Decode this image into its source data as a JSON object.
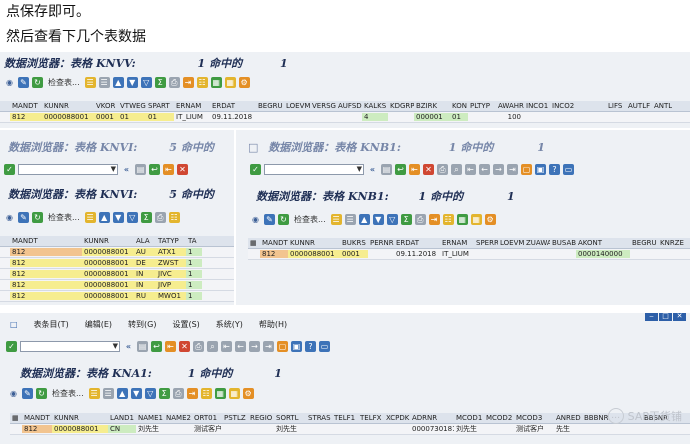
{
  "article": {
    "line1": "点保存即可。",
    "line2": "然后查看下几个表数据"
  },
  "knvv": {
    "title_prefix": "数据浏览器：表格",
    "table": "KNVV:",
    "count": "1",
    "count_label": "命中的",
    "count_total": "1",
    "toolbar_check": "检查表...",
    "columns": [
      "MANDT",
      "KUNNR",
      "VKOR",
      "VTWEG",
      "SPART",
      "ERNAM",
      "ERDAT",
      "BEGRU",
      "LOEVM",
      "VERSG",
      "AUFSD",
      "KALKS",
      "KDGRP",
      "BZIRK",
      "KON",
      "PLTYP",
      "AWAHR",
      "INCO1",
      "INCO2",
      "LIFS",
      "AUTLF",
      "ANTL"
    ],
    "row": [
      "812",
      "0000088001",
      "0001",
      "01",
      "01",
      "IT_LIUM",
      "09.11.2018",
      "",
      "",
      "",
      "",
      "4",
      "",
      "000001",
      "01",
      "",
      "100",
      "",
      "",
      "",
      "",
      ""
    ]
  },
  "knvi": {
    "bg_title_prefix": "数据浏览器：表格",
    "bg_table": "KNVI:",
    "bg_count": "5",
    "bg_count_label": "命中的",
    "title_prefix": "数据浏览器：表格",
    "table": "KNVI:",
    "count": "5",
    "count_label": "命中的",
    "toolbar_check": "检查表...",
    "columns": [
      "MANDT",
      "KUNNR",
      "ALA",
      "TATYP",
      "TA"
    ],
    "rows": [
      [
        "812",
        "0000088001",
        "AU",
        "ATX1",
        "1"
      ],
      [
        "812",
        "0000088001",
        "DE",
        "ZWST",
        "1"
      ],
      [
        "812",
        "0000088001",
        "IN",
        "JIVC",
        "1"
      ],
      [
        "812",
        "0000088001",
        "IN",
        "JIVP",
        "1"
      ],
      [
        "812",
        "0000088001",
        "RU",
        "MWO1",
        "1"
      ]
    ]
  },
  "knb1": {
    "bg_title_prefix": "数据浏览器：表格",
    "bg_table": "KNB1:",
    "bg_count": "1",
    "bg_count_label": "命中的",
    "bg_count_total": "1",
    "title_prefix": "数据浏览器：表格",
    "table": "KNB1:",
    "count": "1",
    "count_label": "命中的",
    "count_total": "1",
    "toolbar_check": "检查表...",
    "columns": [
      "MANDT",
      "KUNNR",
      "BUKRS",
      "PERNR",
      "ERDAT",
      "ERNAM",
      "SPERR",
      "LOEVM",
      "ZUAWA",
      "BUSAB",
      "AKONT",
      "BEGRU",
      "KNRZE"
    ],
    "row": [
      "812",
      "0000088001",
      "0001",
      "",
      "09.11.2018",
      "IT_LIUM",
      "",
      "",
      "",
      "",
      "0000140000",
      "",
      ""
    ]
  },
  "kna1": {
    "menu": [
      "表条目(T)",
      "编辑(E)",
      "转到(G)",
      "设置(S)",
      "系统(Y)",
      "帮助(H)"
    ],
    "title_prefix": "数据浏览器：表格",
    "table": "KNA1:",
    "count": "1",
    "count_label": "命中的",
    "count_total": "1",
    "toolbar_check": "检查表...",
    "columns": [
      "MANDT",
      "KUNNR",
      "LAND1",
      "NAME1",
      "NAME2",
      "ORT01",
      "PSTLZ",
      "REGIO",
      "SORTL",
      "STRAS",
      "TELF1",
      "TELFX",
      "XCPDK",
      "ADRNR",
      "MCOD1",
      "MCOD2",
      "MCOD3",
      "ANRED",
      "BBBNR",
      "BBSNR"
    ],
    "row": [
      "812",
      "0000088001",
      "CN",
      "刘先生",
      "",
      "测试客户",
      "",
      "",
      "刘先生",
      "",
      "",
      "",
      "",
      "0000730181",
      "刘先生",
      "",
      "测试客户",
      "先生",
      "",
      ""
    ]
  },
  "watermark": "SAP干货铺"
}
